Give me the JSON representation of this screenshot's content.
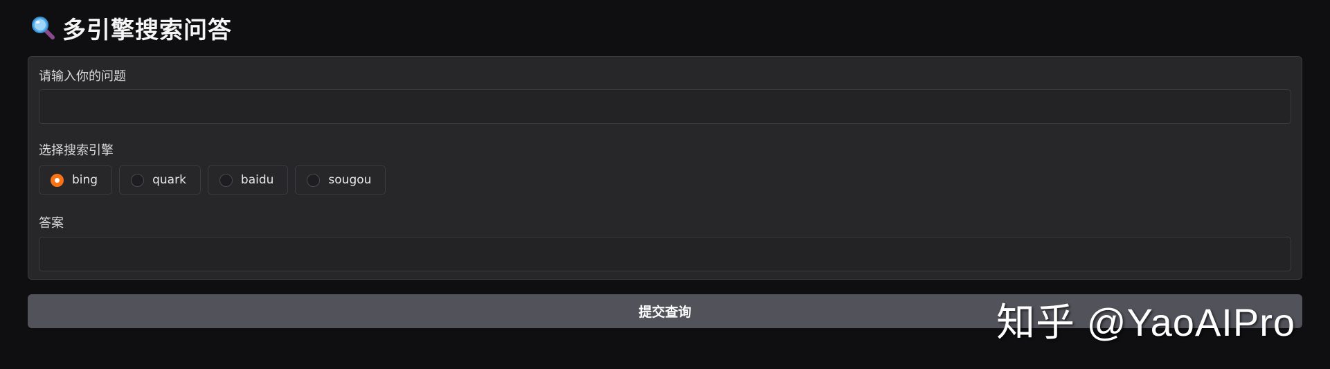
{
  "header": {
    "icon": "magnifier-icon",
    "title": "多引擎搜索问答"
  },
  "question": {
    "label": "请输入你的问题",
    "value": "",
    "placeholder": ""
  },
  "engine": {
    "label": "选择搜索引擎",
    "options": [
      {
        "label": "bing",
        "checked": true
      },
      {
        "label": "quark",
        "checked": false
      },
      {
        "label": "baidu",
        "checked": false
      },
      {
        "label": "sougou",
        "checked": false
      }
    ],
    "selected": "bing"
  },
  "answer": {
    "label": "答案",
    "value": ""
  },
  "submit": {
    "label": "提交查询"
  },
  "watermark": {
    "text": "知乎 @YaoAIPro"
  },
  "colors": {
    "background": "#0f0f12",
    "panel": "#27272a",
    "accent": "#f97316",
    "button": "#52525b"
  }
}
